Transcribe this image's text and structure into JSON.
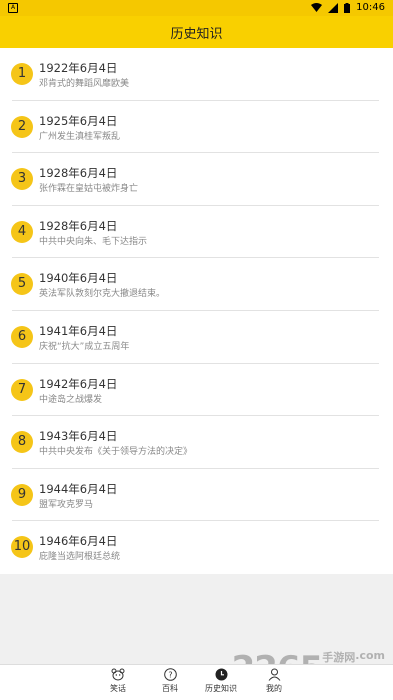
{
  "status_bar": {
    "time": "10:46"
  },
  "header": {
    "title": "历史知识"
  },
  "events": [
    {
      "num": "1",
      "date": "1922年6月4日",
      "desc": "邓肯式的舞蹈风靡欧美"
    },
    {
      "num": "2",
      "date": "1925年6月4日",
      "desc": "广州发生滇桂军叛乱"
    },
    {
      "num": "3",
      "date": "1928年6月4日",
      "desc": "张作霖在皇姑屯被炸身亡"
    },
    {
      "num": "4",
      "date": "1928年6月4日",
      "desc": "中共中央向朱、毛下达指示"
    },
    {
      "num": "5",
      "date": "1940年6月4日",
      "desc": "英法军队敦刻尔克大撤退结束。"
    },
    {
      "num": "6",
      "date": "1941年6月4日",
      "desc": "庆祝“抗大”成立五周年"
    },
    {
      "num": "7",
      "date": "1942年6月4日",
      "desc": "中途岛之战爆发"
    },
    {
      "num": "8",
      "date": "1943年6月4日",
      "desc": "中共中央发布《关于领导方法的决定》"
    },
    {
      "num": "9",
      "date": "1944年6月4日",
      "desc": "盟军攻克罗马"
    },
    {
      "num": "10",
      "date": "1946年6月4日",
      "desc": "庇隆当选阿根廷总统"
    }
  ],
  "tabs": [
    {
      "label": "笑话",
      "icon": "bear-icon"
    },
    {
      "label": "百科",
      "icon": "question-icon"
    },
    {
      "label": "历史知识",
      "icon": "clock-icon"
    },
    {
      "label": "我的",
      "icon": "person-icon"
    }
  ],
  "watermark": {
    "big": "2265",
    "small": "手游网",
    "domain": ".com"
  },
  "colors": {
    "accent": "#f9d000",
    "badge": "#f5c518"
  }
}
